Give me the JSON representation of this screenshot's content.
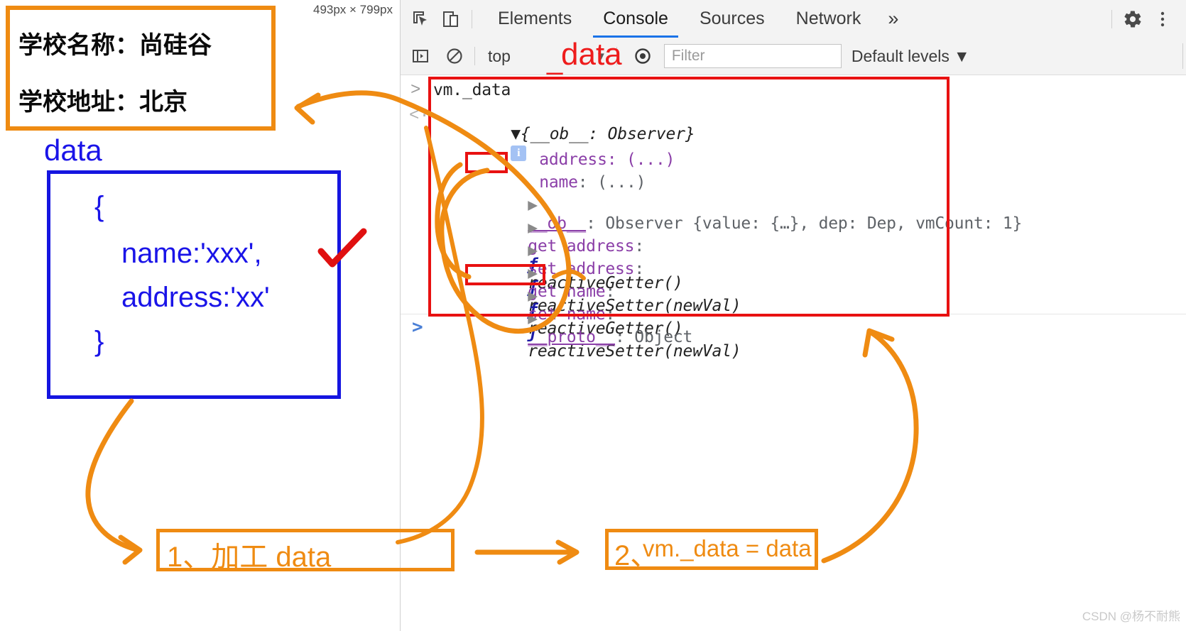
{
  "left_pane": {
    "dimension_label": "493px × 799px",
    "school_box": {
      "line1": "学校名称：尚硅谷",
      "line2": "学校地址：北京"
    },
    "data_caption": "data",
    "code_box": {
      "line1": "{",
      "line2": "name:'xxx',",
      "line3": "address:'xx'",
      "line4": "}"
    }
  },
  "devtools": {
    "icons": {
      "inspect": "inspect-element-icon",
      "device": "device-toolbar-icon",
      "settings": "gear-icon",
      "menu": "kebab-menu-icon",
      "sidebar": "console-sidebar-icon",
      "clear": "clear-console-icon",
      "eye": "live-expression-icon"
    },
    "tabs": [
      {
        "label": "Elements",
        "active": false
      },
      {
        "label": "Console",
        "active": true
      },
      {
        "label": "Sources",
        "active": false
      },
      {
        "label": "Network",
        "active": false
      }
    ],
    "more_tabs": "»",
    "filter_bar": {
      "context": "top",
      "context_caret": "▼",
      "filter_placeholder": "Filter",
      "levels": "Default levels",
      "levels_caret": "▼"
    },
    "console": {
      "input_prompt": ">",
      "input_expression": "vm._data",
      "response_prompt": "<·",
      "next_prompt": ">",
      "lines": [
        {
          "id": "root",
          "text": "▼{__ob__: Observer}",
          "badge": "i"
        },
        {
          "id": "address",
          "text": "address: (...)"
        },
        {
          "id": "name",
          "key": "name",
          "rest": ": (...)"
        },
        {
          "id": "ob",
          "tri": "▶",
          "key": "__ob__",
          "rest": ": Observer {value: {…}, dep: Dep, vmCount: 1}"
        },
        {
          "id": "get-address",
          "tri": "▶",
          "key": "get address",
          "rest": ":",
          "fn": "ƒ",
          "sig": "reactiveGetter()"
        },
        {
          "id": "set-address",
          "tri": "▶",
          "key": "set address",
          "rest": ":",
          "fn": "ƒ",
          "sig": "reactiveSetter(newVal)"
        },
        {
          "id": "get-name",
          "tri": "▶",
          "key": "get name",
          "rest": ":",
          "fn": "ƒ",
          "sig": "reactiveGetter()"
        },
        {
          "id": "set-name",
          "tri": "▶",
          "key": "set name",
          "rest": ":",
          "fn": "ƒ",
          "sig": "reactiveSetter(newVal)"
        },
        {
          "id": "proto",
          "tri": "▶",
          "key": "__proto__",
          "rest": ": Object"
        }
      ]
    }
  },
  "annotations": {
    "red_data_label": "data",
    "red_underscore": "_",
    "step1_text": "1、加工 data",
    "step2_number": "2、",
    "step2_text": "vm._data = data",
    "colors": {
      "orange": "#ef8b12",
      "red": "#e81111",
      "blue": "#1a14e8",
      "accent_blue": "#1a73e8"
    }
  },
  "watermark": "CSDN @杨不耐熊"
}
